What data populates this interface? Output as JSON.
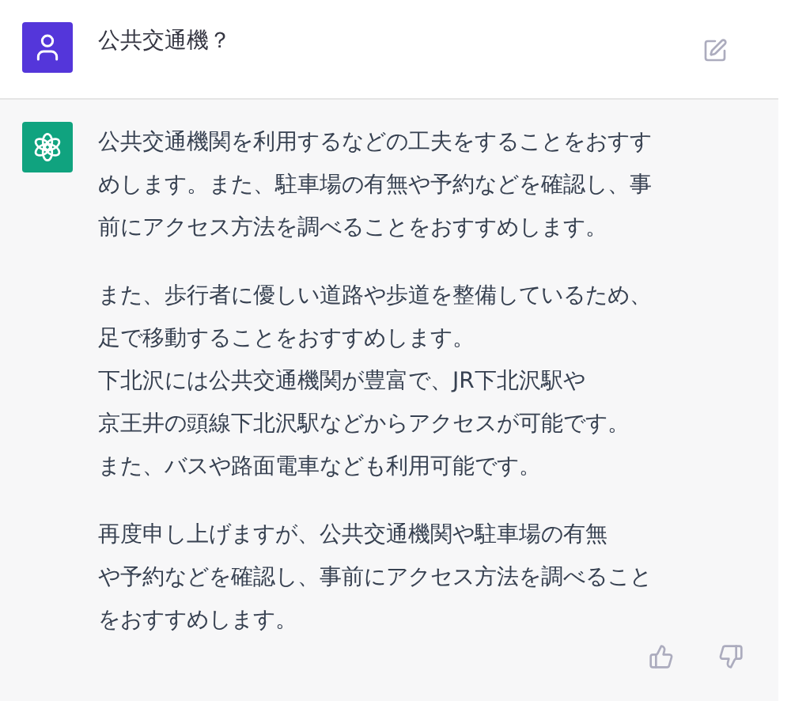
{
  "user_message": {
    "text": "公共交通機？"
  },
  "assistant_message": {
    "paragraphs": [
      [
        "公共交通機関を利用するなどの工夫をすることをおすす",
        "めします。また、駐車場の有無や予約などを確認し、事",
        "前にアクセス方法を調べることをおすすめします。"
      ],
      [
        "また、歩行者に優しい道路や歩道を整備しているため、",
        "足で移動することをおすすめします。",
        "下北沢には公共交通機関が豊富で、JR下北沢駅や",
        "京王井の頭線下北沢駅などからアクセスが可能です。",
        "また、バスや路面電車なども利用可能です。"
      ],
      [
        "再度申し上げますが、公共交通機関や駐車場の有無",
        "や予約などを確認し、事前にアクセス方法を調べること",
        "をおすすめします。"
      ]
    ]
  }
}
